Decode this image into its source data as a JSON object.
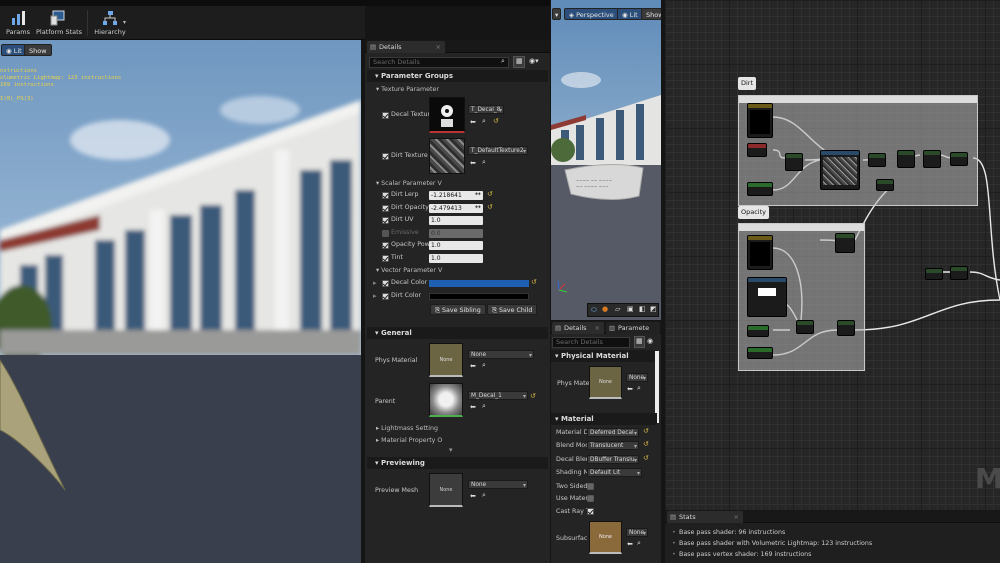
{
  "toolbar": {
    "items": [
      {
        "label": "Params",
        "icon": "params-icon"
      },
      {
        "label": "Platform Stats",
        "icon": "platform-stats-icon"
      },
      {
        "label": "Hierarchy",
        "icon": "hierarchy-icon"
      }
    ]
  },
  "viewport_left": {
    "lit_label": "Lit",
    "show_label": "Show",
    "overlay_lines": [
      "nstructions",
      "olumetric Lightmap: 123 instructions",
      "169 instructions",
      "I(0)_PS(3)"
    ]
  },
  "details": {
    "tab_label": "Details",
    "search_placeholder": "Search Details",
    "parameter_groups": "Parameter Groups",
    "texture_param_header": "Texture Parameter",
    "decal_texture": {
      "label": "Decal Texture",
      "value": "T_Decal_8"
    },
    "dirt_texture": {
      "label": "Dirt Texture",
      "value": "T_DefaultTexture2"
    },
    "scalar_param_header": "Scalar Parameter V",
    "scalars": [
      {
        "label": "Dirt Lerp",
        "value": "-1.218641",
        "checked": true,
        "enabled": true
      },
      {
        "label": "Dirt Opacity P",
        "value": "-2.479413",
        "checked": true,
        "enabled": true
      },
      {
        "label": "Dirt UV",
        "value": "1.0",
        "checked": true,
        "enabled": true
      },
      {
        "label": "Emissive",
        "value": "0.0",
        "checked": false,
        "enabled": false
      },
      {
        "label": "Opacity Powe",
        "value": "1.0",
        "checked": true,
        "enabled": true
      },
      {
        "label": "Tint",
        "value": "1.0",
        "checked": true,
        "enabled": true
      }
    ],
    "vector_param_header": "Vector Parameter V",
    "vectors": [
      {
        "label": "Decal Color",
        "color": "#1e5fb4"
      },
      {
        "label": "Dirt Color",
        "color": "#000000"
      }
    ],
    "save_sibling": "Save Sibling",
    "save_child": "Save Child",
    "general_header": "General",
    "phys_material": {
      "label": "Phys Material",
      "thumb_text": "None",
      "value": "None"
    },
    "parent": {
      "label": "Parent",
      "value": "M_Decal_1"
    },
    "lightmass_settings": "Lightmass Setting",
    "material_property": "Material Property O",
    "previewing_header": "Previewing",
    "preview_mesh": {
      "label": "Preview Mesh",
      "thumb_text": "None",
      "value": "None"
    }
  },
  "preview": {
    "perspective_label": "Perspective",
    "lit_label": "Lit",
    "show_label": "Show"
  },
  "details2": {
    "tab_details": "Details",
    "tab_parameters": "Paramete",
    "search_placeholder": "Search Details",
    "physical_material_header": "Physical Material",
    "phys_material": {
      "label": "Phys Mate",
      "thumb_text": "None",
      "value": "None"
    },
    "material_header": "Material",
    "rows": [
      {
        "label": "Material D",
        "value": "Deferred Decal"
      },
      {
        "label": "Blend Mod",
        "value": "Translucent"
      },
      {
        "label": "Decal Blen",
        "value": "DBuffer Translu"
      },
      {
        "label": "Shading M",
        "value": "Default Lit"
      }
    ],
    "two_sided": "Two Sided",
    "use_material": "Use Mater",
    "cast_ray": "Cast Ray T",
    "subsurface": {
      "label": "Subsurfac",
      "thumb_text": "None",
      "value": "None"
    }
  },
  "graph": {
    "comment_dirt": "Dirt",
    "comment_opacity": "Opacity",
    "watermark": "M"
  },
  "stats": {
    "tab_label": "Stats",
    "lines": [
      "Base pass shader: 96 instructions",
      "Base pass shader with Volumetric Lightmap: 123 instructions",
      "Base pass vertex shader: 169 instructions"
    ]
  }
}
